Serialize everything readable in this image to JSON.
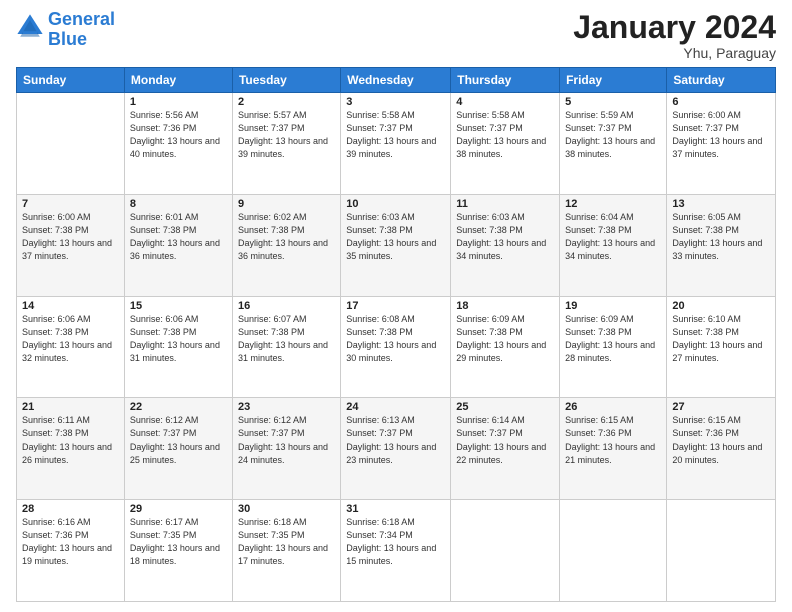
{
  "header": {
    "logo_line1": "General",
    "logo_line2": "Blue",
    "month": "January 2024",
    "location": "Yhu, Paraguay"
  },
  "days_of_week": [
    "Sunday",
    "Monday",
    "Tuesday",
    "Wednesday",
    "Thursday",
    "Friday",
    "Saturday"
  ],
  "weeks": [
    [
      {
        "day": "",
        "sunrise": "",
        "sunset": "",
        "daylight": ""
      },
      {
        "day": "1",
        "sunrise": "5:56 AM",
        "sunset": "7:36 PM",
        "daylight": "13 hours and 40 minutes."
      },
      {
        "day": "2",
        "sunrise": "5:57 AM",
        "sunset": "7:37 PM",
        "daylight": "13 hours and 39 minutes."
      },
      {
        "day": "3",
        "sunrise": "5:58 AM",
        "sunset": "7:37 PM",
        "daylight": "13 hours and 39 minutes."
      },
      {
        "day": "4",
        "sunrise": "5:58 AM",
        "sunset": "7:37 PM",
        "daylight": "13 hours and 38 minutes."
      },
      {
        "day": "5",
        "sunrise": "5:59 AM",
        "sunset": "7:37 PM",
        "daylight": "13 hours and 38 minutes."
      },
      {
        "day": "6",
        "sunrise": "6:00 AM",
        "sunset": "7:37 PM",
        "daylight": "13 hours and 37 minutes."
      }
    ],
    [
      {
        "day": "7",
        "sunrise": "6:00 AM",
        "sunset": "7:38 PM",
        "daylight": "13 hours and 37 minutes."
      },
      {
        "day": "8",
        "sunrise": "6:01 AM",
        "sunset": "7:38 PM",
        "daylight": "13 hours and 36 minutes."
      },
      {
        "day": "9",
        "sunrise": "6:02 AM",
        "sunset": "7:38 PM",
        "daylight": "13 hours and 36 minutes."
      },
      {
        "day": "10",
        "sunrise": "6:03 AM",
        "sunset": "7:38 PM",
        "daylight": "13 hours and 35 minutes."
      },
      {
        "day": "11",
        "sunrise": "6:03 AM",
        "sunset": "7:38 PM",
        "daylight": "13 hours and 34 minutes."
      },
      {
        "day": "12",
        "sunrise": "6:04 AM",
        "sunset": "7:38 PM",
        "daylight": "13 hours and 34 minutes."
      },
      {
        "day": "13",
        "sunrise": "6:05 AM",
        "sunset": "7:38 PM",
        "daylight": "13 hours and 33 minutes."
      }
    ],
    [
      {
        "day": "14",
        "sunrise": "6:06 AM",
        "sunset": "7:38 PM",
        "daylight": "13 hours and 32 minutes."
      },
      {
        "day": "15",
        "sunrise": "6:06 AM",
        "sunset": "7:38 PM",
        "daylight": "13 hours and 31 minutes."
      },
      {
        "day": "16",
        "sunrise": "6:07 AM",
        "sunset": "7:38 PM",
        "daylight": "13 hours and 31 minutes."
      },
      {
        "day": "17",
        "sunrise": "6:08 AM",
        "sunset": "7:38 PM",
        "daylight": "13 hours and 30 minutes."
      },
      {
        "day": "18",
        "sunrise": "6:09 AM",
        "sunset": "7:38 PM",
        "daylight": "13 hours and 29 minutes."
      },
      {
        "day": "19",
        "sunrise": "6:09 AM",
        "sunset": "7:38 PM",
        "daylight": "13 hours and 28 minutes."
      },
      {
        "day": "20",
        "sunrise": "6:10 AM",
        "sunset": "7:38 PM",
        "daylight": "13 hours and 27 minutes."
      }
    ],
    [
      {
        "day": "21",
        "sunrise": "6:11 AM",
        "sunset": "7:38 PM",
        "daylight": "13 hours and 26 minutes."
      },
      {
        "day": "22",
        "sunrise": "6:12 AM",
        "sunset": "7:37 PM",
        "daylight": "13 hours and 25 minutes."
      },
      {
        "day": "23",
        "sunrise": "6:12 AM",
        "sunset": "7:37 PM",
        "daylight": "13 hours and 24 minutes."
      },
      {
        "day": "24",
        "sunrise": "6:13 AM",
        "sunset": "7:37 PM",
        "daylight": "13 hours and 23 minutes."
      },
      {
        "day": "25",
        "sunrise": "6:14 AM",
        "sunset": "7:37 PM",
        "daylight": "13 hours and 22 minutes."
      },
      {
        "day": "26",
        "sunrise": "6:15 AM",
        "sunset": "7:36 PM",
        "daylight": "13 hours and 21 minutes."
      },
      {
        "day": "27",
        "sunrise": "6:15 AM",
        "sunset": "7:36 PM",
        "daylight": "13 hours and 20 minutes."
      }
    ],
    [
      {
        "day": "28",
        "sunrise": "6:16 AM",
        "sunset": "7:36 PM",
        "daylight": "13 hours and 19 minutes."
      },
      {
        "day": "29",
        "sunrise": "6:17 AM",
        "sunset": "7:35 PM",
        "daylight": "13 hours and 18 minutes."
      },
      {
        "day": "30",
        "sunrise": "6:18 AM",
        "sunset": "7:35 PM",
        "daylight": "13 hours and 17 minutes."
      },
      {
        "day": "31",
        "sunrise": "6:18 AM",
        "sunset": "7:34 PM",
        "daylight": "13 hours and 15 minutes."
      },
      {
        "day": "",
        "sunrise": "",
        "sunset": "",
        "daylight": ""
      },
      {
        "day": "",
        "sunrise": "",
        "sunset": "",
        "daylight": ""
      },
      {
        "day": "",
        "sunrise": "",
        "sunset": "",
        "daylight": ""
      }
    ]
  ],
  "labels": {
    "sunrise_prefix": "Sunrise: ",
    "sunset_prefix": "Sunset: ",
    "daylight_prefix": "Daylight: "
  }
}
